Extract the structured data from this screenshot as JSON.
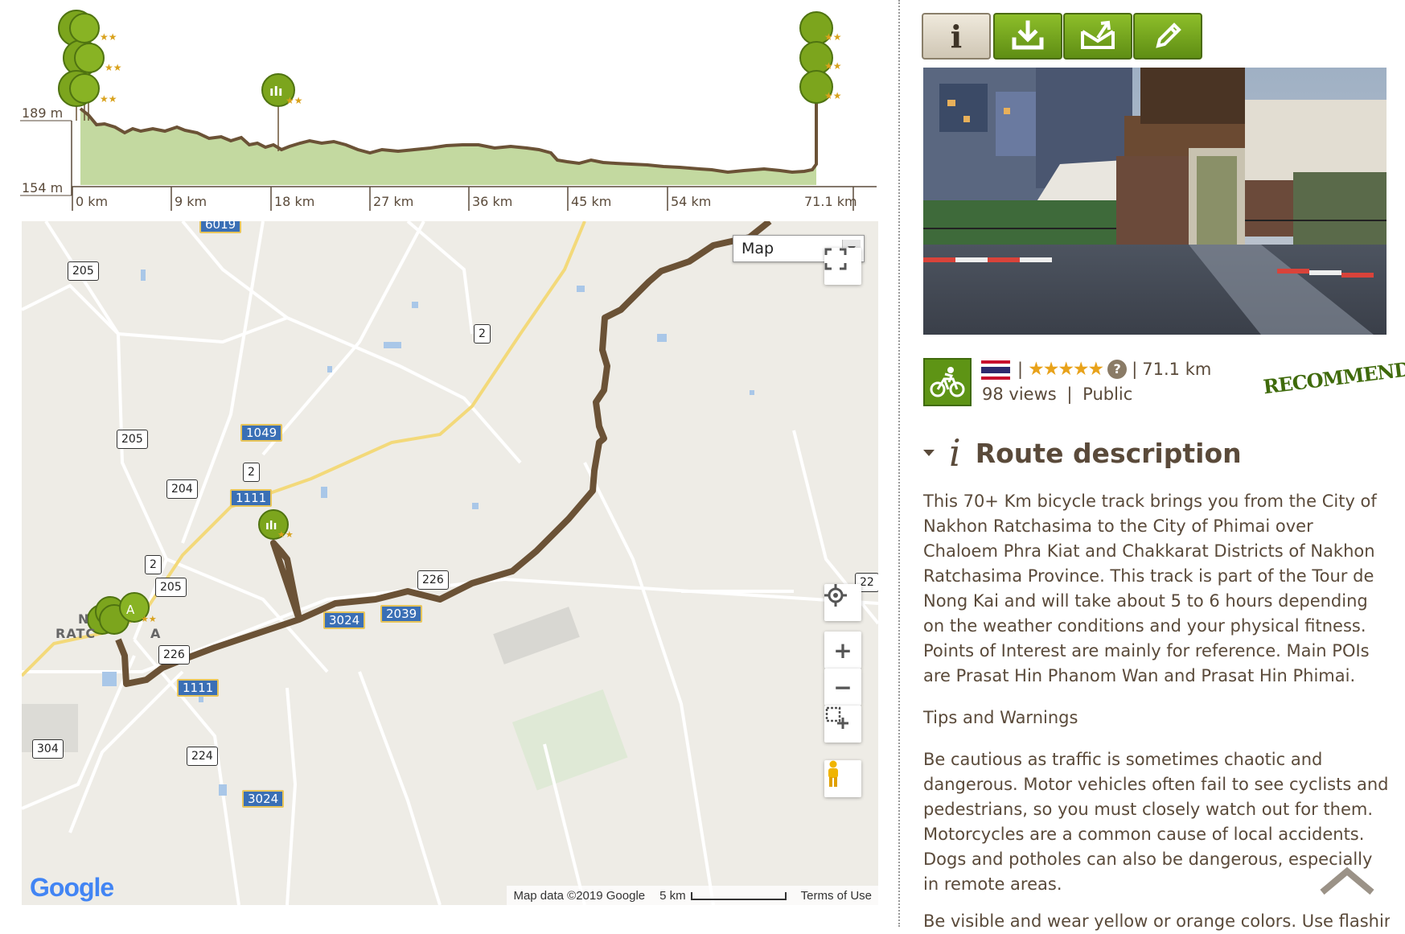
{
  "elevation": {
    "y_labels": [
      "189 m",
      "154 m"
    ],
    "x_labels": [
      "0 km",
      "9 km",
      "18 km",
      "27 km",
      "36 km",
      "45 km",
      "54 km",
      "71.1 km"
    ]
  },
  "map": {
    "type_selector": "Map",
    "road_shields_blue": [
      "6019",
      "1049",
      "1111",
      "3024",
      "2039",
      "1111",
      "3024"
    ],
    "road_shields_white": [
      "205",
      "2",
      "205",
      "204",
      "2",
      "2",
      "205",
      "226",
      "304",
      "224",
      "226",
      "22"
    ],
    "place_label_1": "N",
    "place_label_2": "RATC",
    "place_label_3": "A",
    "attribution": "Map data ©2019 Google",
    "scale_label": "5 km",
    "terms": "Terms of Use",
    "logo": "Google",
    "colors": {
      "route": "#6b5236",
      "poi": "#7ca51d",
      "background": "#eeece6"
    }
  },
  "toolbar": {
    "icons": [
      "info-icon",
      "download-icon",
      "send-icon",
      "edit-icon"
    ]
  },
  "route": {
    "separator_1": "|",
    "separator_2": "|",
    "rating_stars": "★★★★★",
    "help_glyph": "?",
    "distance": "71.1 km",
    "views": "98 views",
    "separator_3": "|",
    "visibility": "Public",
    "badge": "RECOMMENDED"
  },
  "description": {
    "section_icon": "i",
    "heading": "Route description",
    "paragraph_1": "This 70+ Km bicycle track brings you from the City of Nakhon Ratchasima to the City of Phimai over Chaloem Phra Kiat and Chakkarat Districts of Nakhon Ratchasima Province. This track is part of the Tour de Nong Kai and will take about 5 to 6 hours depending on the weather conditions and your physical fitness. Points of Interest are mainly for reference. Main POIs are Prasat Hin Phanom Wan and Prasat Hin Phimai.",
    "paragraph_2": "Tips and Warnings",
    "paragraph_3": "Be cautious as traffic is sometimes chaotic and dangerous. Motor vehicles often fail to see cyclists and pedestrians, so you must closely watch out for them. Motorcycles are a common cause of local accidents. Dogs and potholes can also be dangerous, especially in remote areas.",
    "paragraph_4": "Be visible and wear yellow or orange colors. Use flashing"
  }
}
